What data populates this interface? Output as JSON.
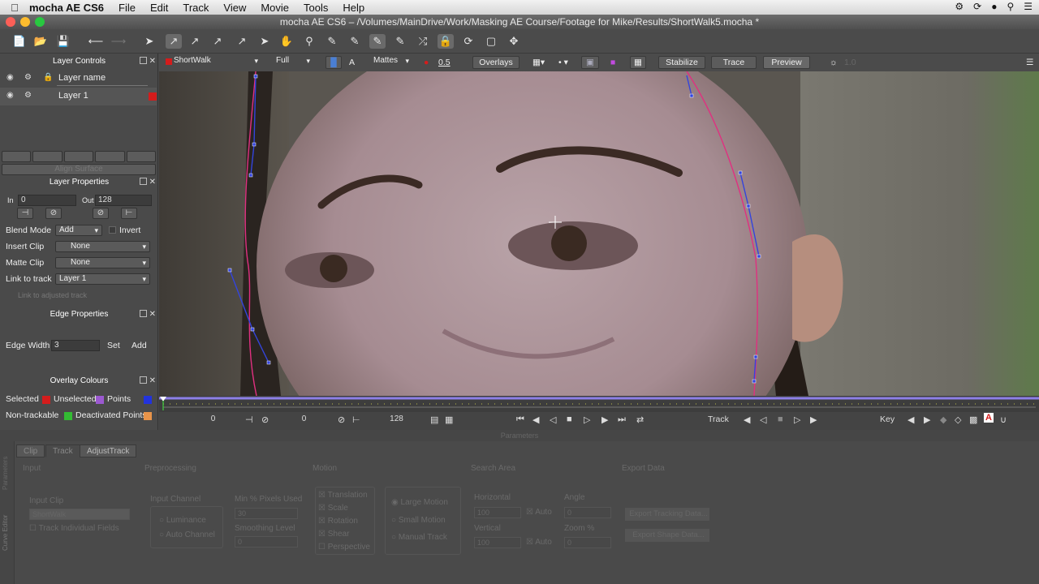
{
  "menubar": {
    "app": "mocha AE CS6",
    "items": [
      "File",
      "Edit",
      "Track",
      "View",
      "Movie",
      "Tools",
      "Help"
    ]
  },
  "window": {
    "title": "mocha AE CS6 – /Volumes/MainDrive/Work/Masking AE Course/Footage for Mike/Results/ShortWalk5.mocha *"
  },
  "viewer_bar": {
    "clip": "ShortWalk",
    "resolution": "Full",
    "mattes": "Mattes",
    "opacity": "0.5",
    "overlays": "Overlays",
    "stabilize": "Stabilize",
    "trace": "Trace",
    "preview": "Preview",
    "brightness": "1.0"
  },
  "layer_controls": {
    "title": "Layer Controls",
    "header": "Layer name",
    "layers": [
      {
        "name": "Layer 1",
        "color": "#d41c1c"
      }
    ],
    "align_surface": "Align Surface"
  },
  "layer_properties": {
    "title": "Layer Properties",
    "in_label": "In",
    "in_value": "0",
    "out_label": "Out",
    "out_value": "128",
    "blend_mode_label": "Blend Mode",
    "blend_mode": "Add",
    "invert_label": "Invert",
    "insert_clip_label": "Insert Clip",
    "insert_clip": "None",
    "matte_clip_label": "Matte Clip",
    "matte_clip": "None",
    "link_to_track_label": "Link to track",
    "link_to_track": "Layer 1",
    "link_adjusted": "Link to adjusted track"
  },
  "edge_properties": {
    "title": "Edge Properties",
    "edge_width_label": "Edge Width",
    "edge_width": "3",
    "set": "Set",
    "add": "Add"
  },
  "overlay_colours": {
    "title": "Overlay Colours",
    "selected": "Selected",
    "selected_color": "#d41c1c",
    "unselected": "Unselected",
    "unselected_color": "#9b59d0",
    "points": "Points",
    "points_color": "#2233dd",
    "non_trackable": "Non-trackable",
    "non_trackable_color": "#33bb33",
    "deactivated": "Deactivated Points",
    "deactivated_color": "#e8944a"
  },
  "transport": {
    "start": "0",
    "current": "0",
    "end": "128",
    "track": "Track",
    "key": "Key"
  },
  "params": {
    "bar": "Parameters",
    "tabs": [
      "Clip",
      "Track",
      "AdjustTrack"
    ],
    "groups": [
      "Input",
      "Preprocessing",
      "Motion",
      "Search Area",
      "Export Data"
    ],
    "input_clip": "Input Clip",
    "input_clip_value": "ShortWalk",
    "track_individual": "Track Individual Fields",
    "input_channel": "Input Channel",
    "luminance": "Luminance",
    "auto_channel": "Auto Channel",
    "min_pixels": "Min % Pixels Used",
    "min_pixels_value": "30",
    "smoothing": "Smoothing Level",
    "smoothing_value": "0",
    "motion": [
      "Translation",
      "Scale",
      "Rotation",
      "Shear",
      "Perspective"
    ],
    "large_motion": "Large Motion",
    "small_motion": "Small Motion",
    "manual_track": "Manual Track",
    "horizontal": "Horizontal",
    "horizontal_value": "100",
    "auto": "Auto",
    "angle": "Angle",
    "angle_value": "0",
    "vertical": "Vertical",
    "vertical_value": "100",
    "zoom": "Zoom %",
    "zoom_value": "0",
    "export_tracking": "Export Tracking Data...",
    "export_shape": "Export Shape Data...",
    "side_params": "Parameters",
    "side_curve": "Curve Editor"
  }
}
